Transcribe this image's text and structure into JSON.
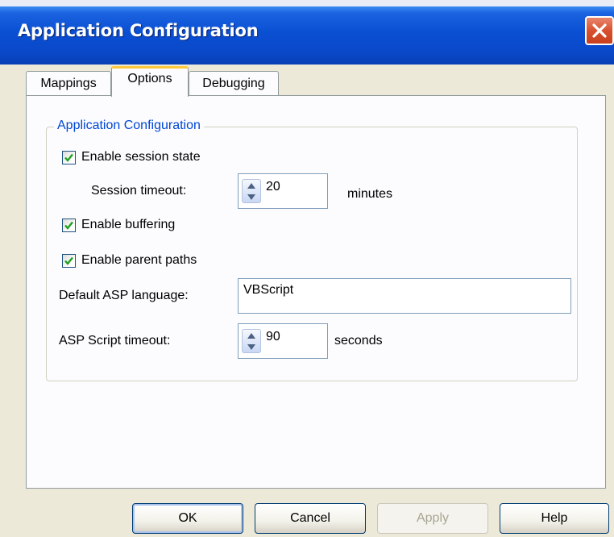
{
  "window": {
    "title": "Application Configuration"
  },
  "tabs": [
    {
      "label": "Mappings",
      "active": false
    },
    {
      "label": "Options",
      "active": true
    },
    {
      "label": "Debugging",
      "active": false
    }
  ],
  "group": {
    "title": "Application Configuration",
    "enable_session_state": {
      "label": "Enable session state",
      "checked": true
    },
    "session_timeout": {
      "label": "Session timeout:",
      "value": "20",
      "unit": "minutes"
    },
    "enable_buffering": {
      "label": "Enable buffering",
      "checked": true
    },
    "enable_parent_paths": {
      "label": "Enable parent paths",
      "checked": true
    },
    "default_language": {
      "label": "Default ASP language:",
      "value": "VBScript"
    },
    "script_timeout": {
      "label": "ASP Script timeout:",
      "value": "90",
      "unit": "seconds"
    }
  },
  "buttons": {
    "ok": "OK",
    "cancel": "Cancel",
    "apply": "Apply",
    "help": "Help"
  },
  "colors": {
    "title_bar": "#0a4fd3",
    "group_title": "#0046d5",
    "check_mark": "#21a121",
    "active_tab_accent": "#ffc83c"
  },
  "icons": {
    "close": "close-icon",
    "check": "check-icon",
    "spin": "spin-arrows-icon"
  }
}
